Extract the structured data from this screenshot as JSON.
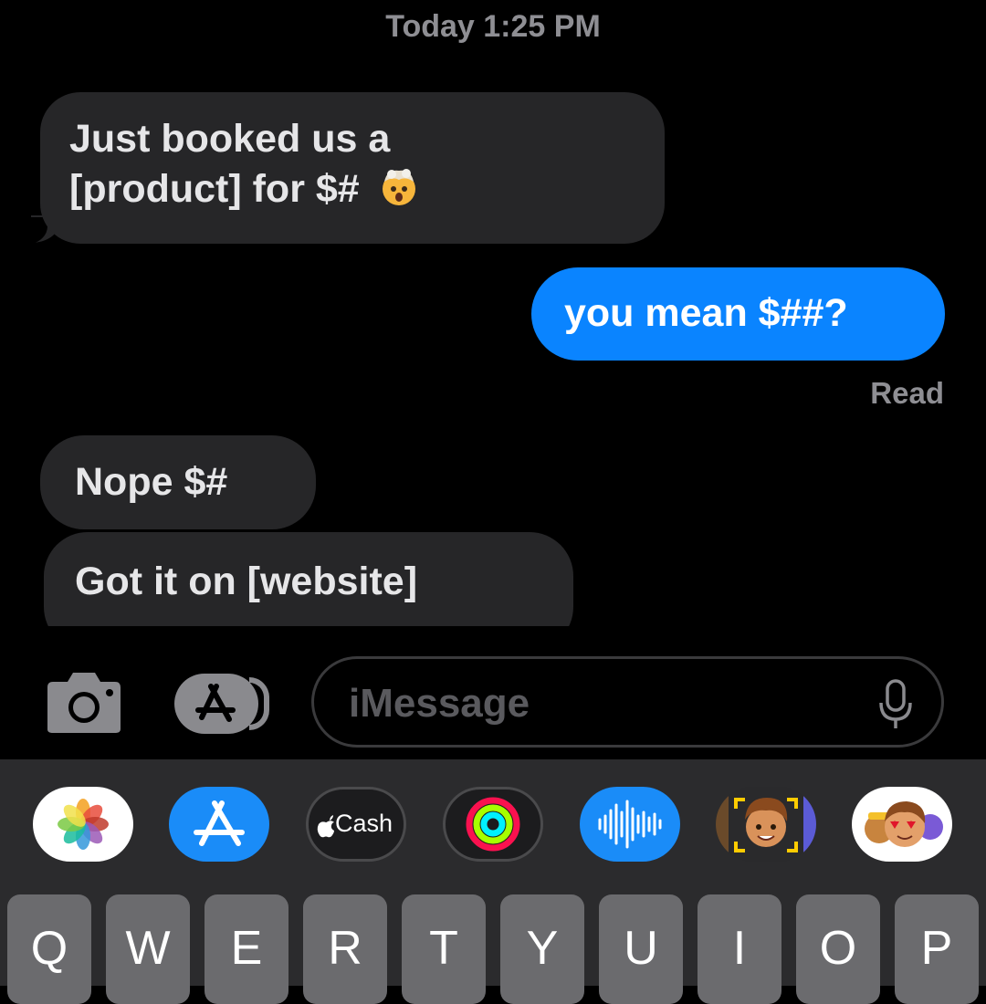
{
  "timestamp": "Today 1:25 PM",
  "messages": [
    {
      "direction": "incoming",
      "line1": "Just booked us a",
      "line2": "[product] for $#",
      "emoji": "exploding-head"
    },
    {
      "direction": "outgoing",
      "text": "you mean $##?"
    },
    {
      "direction": "incoming",
      "text": "Nope $#"
    },
    {
      "direction": "incoming",
      "text": "Got it on [website]"
    }
  ],
  "read_receipt": "Read",
  "input": {
    "placeholder": "iMessage"
  },
  "apps": [
    {
      "name": "photos",
      "label": ""
    },
    {
      "name": "app-store",
      "label": ""
    },
    {
      "name": "apple-cash",
      "label": "Cash"
    },
    {
      "name": "activity",
      "label": ""
    },
    {
      "name": "audio",
      "label": ""
    },
    {
      "name": "memoji",
      "label": ""
    },
    {
      "name": "memoji-stickers",
      "label": ""
    }
  ],
  "keyboard": {
    "row1": [
      "Q",
      "W",
      "E",
      "R",
      "T",
      "Y",
      "U",
      "I",
      "O",
      "P"
    ]
  },
  "colors": {
    "outgoing": "#0a84ff",
    "incoming": "#262628",
    "background": "#000000"
  }
}
